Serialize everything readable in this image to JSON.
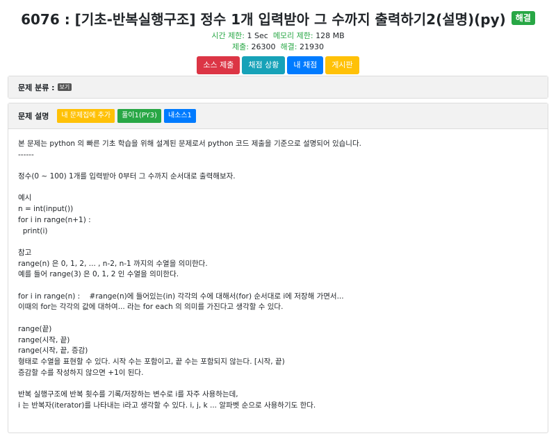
{
  "problem": {
    "title": "6076 : [기초-반복실행구조] 정수 1개 입력받아 그 수까지 출력하기2(설명)(py)",
    "solved_badge": "해결",
    "time_limit_label": "시간 제한:",
    "time_limit": "1 Sec",
    "memory_limit_label": "메모리 제한:",
    "memory_limit": "128 MB",
    "submit_label": "제출:",
    "submit_count": "26300",
    "solved_label": "해결:",
    "solved_count": "21930"
  },
  "actions": {
    "submit_source": "소스 제출",
    "grading_status": "채점 상황",
    "my_grading": "내 채점",
    "board": "게시판"
  },
  "category": {
    "label": "문제 분류 :",
    "see": "보기"
  },
  "description": {
    "label": "문제 설명",
    "add_to_collection": "내 문제집에 추가",
    "solution": "풀이1(PY3)",
    "my_source": "내소스1",
    "lines": [
      "본 문제는 python 의 빠른 기초 학습을 위해 설계된 문제로서 python 코드 제출을 기준으로 설명되어 있습니다.",
      "------",
      "",
      "정수(0 ~ 100) 1개를 입력받아 0부터 그 수까지 순서대로 출력해보자.",
      "",
      "예시",
      "n = int(input())",
      "for i in range(n+1) :",
      "  print(i)",
      "",
      "참고",
      "range(n) 은 0, 1, 2, ... , n-2, n-1 까지의 수열을 의미한다.",
      "예를 들어 range(3) 은 0, 1, 2 인 수열을 의미한다.",
      "",
      "for i in range(n) :    #range(n)에 들어있는(in) 각각의 수에 대해서(for) 순서대로 i에 저장해 가면서...",
      "이때의 for는 각각의 값에 대하여... 라는 for each 의 의미를 가진다고 생각할 수 있다.",
      "",
      "range(끝)",
      "range(시작, 끝)",
      "range(시작, 끝, 증감)",
      "형태로 수열을 표현할 수 있다. 시작 수는 포함이고, 끝 수는 포함되지 않는다. [시작, 끝)",
      "증감할 수를 작성하지 않으면 +1이 된다.",
      "",
      "반복 실행구조에 반복 횟수를 기록/저장하는 변수로 i를 자주 사용하는데,",
      "i 는 반복자(iterator)를 나타내는 i라고 생각할 수 있다. i, j, k ... 알파벳 순으로 사용하기도 한다."
    ]
  }
}
